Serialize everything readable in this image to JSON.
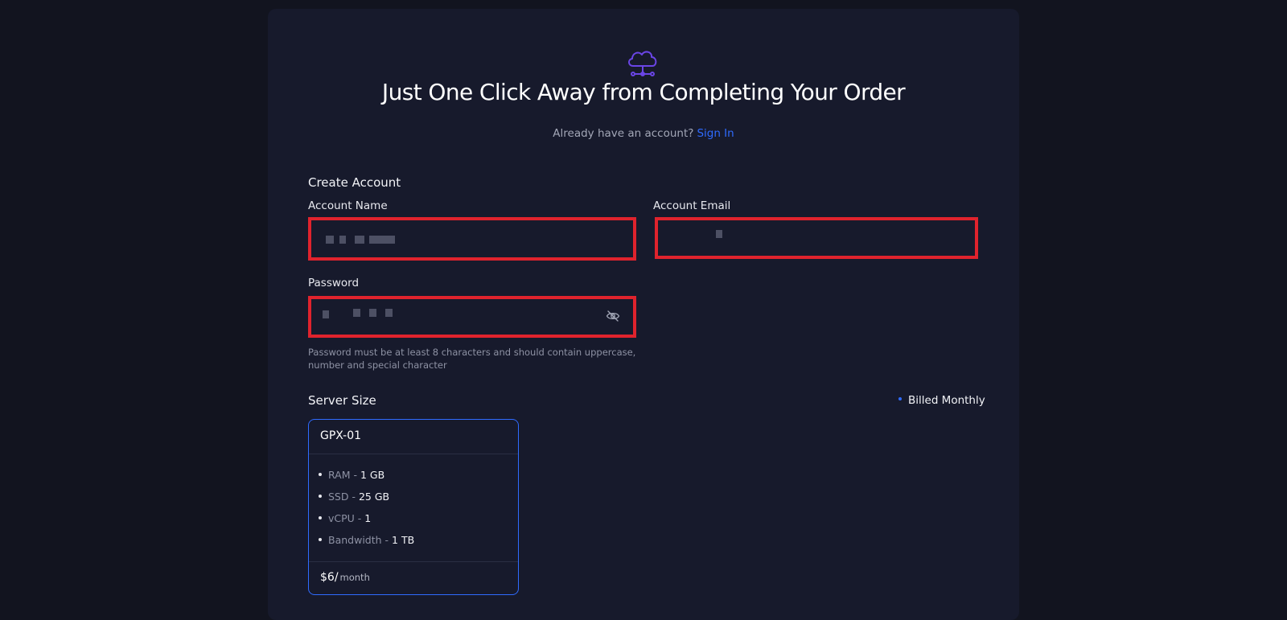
{
  "header": {
    "title": "Just One Click Away from Completing Your Order",
    "signin_prompt": "Already have an account?",
    "signin_link": "Sign In"
  },
  "account": {
    "section_title": "Create Account",
    "name_label": "Account Name",
    "email_label": "Account Email",
    "password_label": "Password",
    "password_hint": "Password must be at least 8 characters and should contain uppercase, number and special character"
  },
  "server": {
    "section_title": "Server Size",
    "billing": "Billed Monthly",
    "plan": {
      "name": "GPX-01",
      "specs": [
        {
          "label": "RAM -",
          "value": "1 GB"
        },
        {
          "label": "SSD -",
          "value": "25 GB"
        },
        {
          "label": "vCPU -",
          "value": "1"
        },
        {
          "label": "Bandwidth -",
          "value": "1 TB"
        }
      ],
      "price": "$6/",
      "period": "month"
    }
  },
  "colors": {
    "accent": "#2f6bff",
    "highlight_border": "#e0232d",
    "logo": "#6a45e6",
    "background": "#12141f",
    "panel": "#171a2c"
  },
  "icons": {
    "logo": "cloud-network-icon",
    "password_toggle": "eye-off-icon"
  }
}
